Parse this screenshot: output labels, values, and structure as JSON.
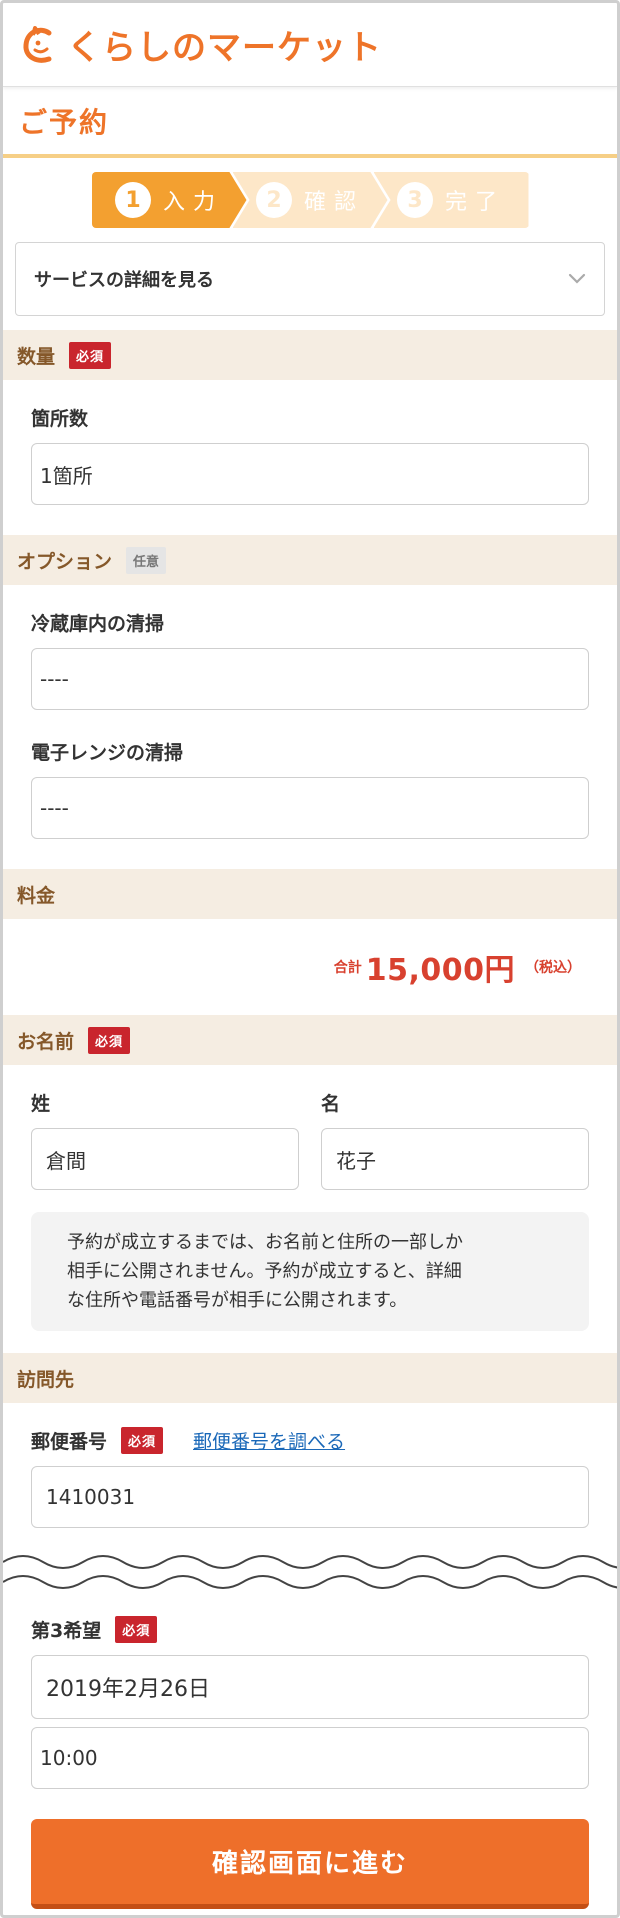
{
  "header": {
    "logo_text": "くらしのマーケット",
    "logo_color": "#ee7429"
  },
  "page": {
    "title": "ご予約"
  },
  "steps": [
    {
      "num": "1",
      "label": "入力",
      "state": "active"
    },
    {
      "num": "2",
      "label": "確認",
      "state": "todo"
    },
    {
      "num": "3",
      "label": "完了",
      "state": "todo"
    }
  ],
  "accordion": {
    "label": "サービスの詳細を見る",
    "icon": "chevron-down-icon"
  },
  "sections": {
    "quantity": {
      "title": "数量",
      "badge": "必須"
    },
    "options": {
      "title": "オプション",
      "badge": "任意"
    },
    "price": {
      "title": "料金"
    },
    "name": {
      "title": "お名前",
      "badge": "必須"
    },
    "visit": {
      "title": "訪問先"
    }
  },
  "fields": {
    "spots": {
      "label": "箇所数",
      "value": "1箇所"
    },
    "fridge": {
      "label": "冷蔵庫内の清掃",
      "value": "----"
    },
    "microwave": {
      "label": "電子レンジの清掃",
      "value": "----"
    },
    "last_name": {
      "label": "姓",
      "value": "倉間"
    },
    "first_name": {
      "label": "名",
      "value": "花子"
    },
    "zip": {
      "label": "郵便番号",
      "badge": "必須",
      "link": "郵便番号を調べる",
      "value": "1410031"
    },
    "third_choice": {
      "label": "第3希望",
      "badge": "必須",
      "date": "2019年2月26日",
      "time": "10:00"
    }
  },
  "price": {
    "prefix": "合計",
    "amount": "15,000円",
    "suffix": "（税込）"
  },
  "note_lines": [
    "予約が成立するまでは、お名前と住所の一部しか",
    "相手に公開されません。予約が成立すると、詳細",
    "な住所や電話番号が相手に公開されます。"
  ],
  "submit": {
    "label": "確認画面に進む"
  },
  "colors": {
    "accent": "#ee6f2a",
    "required": "#c9252d",
    "section_bg": "#f5ede2",
    "link": "#1a68b8"
  }
}
